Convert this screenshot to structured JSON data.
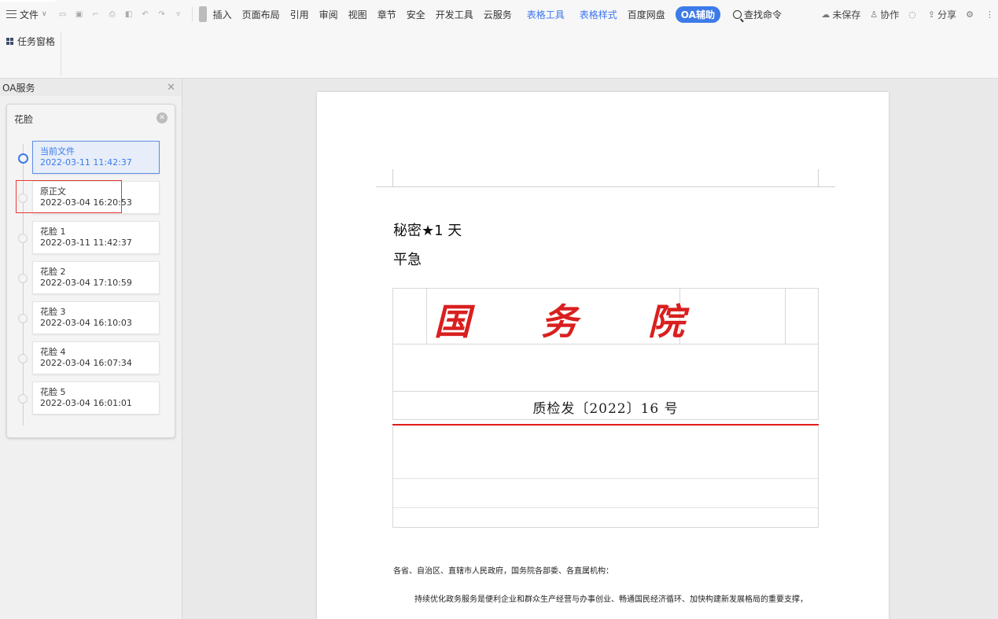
{
  "menubar": {
    "file_label": "文件",
    "items": [
      "插入",
      "页面布局",
      "引用",
      "审阅",
      "视图",
      "章节",
      "安全",
      "开发工具",
      "云服务"
    ],
    "context_items": [
      "表格工具",
      "表格样式"
    ],
    "baidu_label": "百度网盘",
    "oa_label": "OA辅助",
    "search_label": "查找命令",
    "unsaved_label": "未保存",
    "collab_label": "协作",
    "share_label": "分享",
    "accent_color": "#3c74f0"
  },
  "toolbar2": {
    "task_pane_label": "任务窗格"
  },
  "sidepanel": {
    "title": "OA服务",
    "card_title": "花脸",
    "versions": [
      {
        "name": "当前文件",
        "time": "2022-03-11 11:42:37",
        "active": true
      },
      {
        "name": "原正文",
        "time": "2022-03-04 16:20:53",
        "active": false
      },
      {
        "name": "花脸 1",
        "time": "2022-03-11 11:42:37",
        "active": false
      },
      {
        "name": "花脸 2",
        "time": "2022-03-04 17:10:59",
        "active": false
      },
      {
        "name": "花脸 3",
        "time": "2022-03-04 16:10:03",
        "active": false
      },
      {
        "name": "花脸 4",
        "time": "2022-03-04 16:07:34",
        "active": false
      },
      {
        "name": "花脸 5",
        "time": "2022-03-04 16:01:01",
        "active": false
      }
    ]
  },
  "document": {
    "secret_level": "秘密★1 天",
    "urgency": "平急",
    "issuer": [
      "国",
      "务",
      "院"
    ],
    "doc_number": "质检发〔2022〕16 号",
    "addressee": "各省、自治区、直辖市人民政府，国务院各部委、各直属机构：",
    "body_first_line": "持续优化政务服务是便利企业和群众生产经营与办事创业、畅通国民经济循环、加快构建新发展格局的重要支撑，",
    "issuer_color": "#d91f1f",
    "rule_color": "#e01b1b"
  }
}
